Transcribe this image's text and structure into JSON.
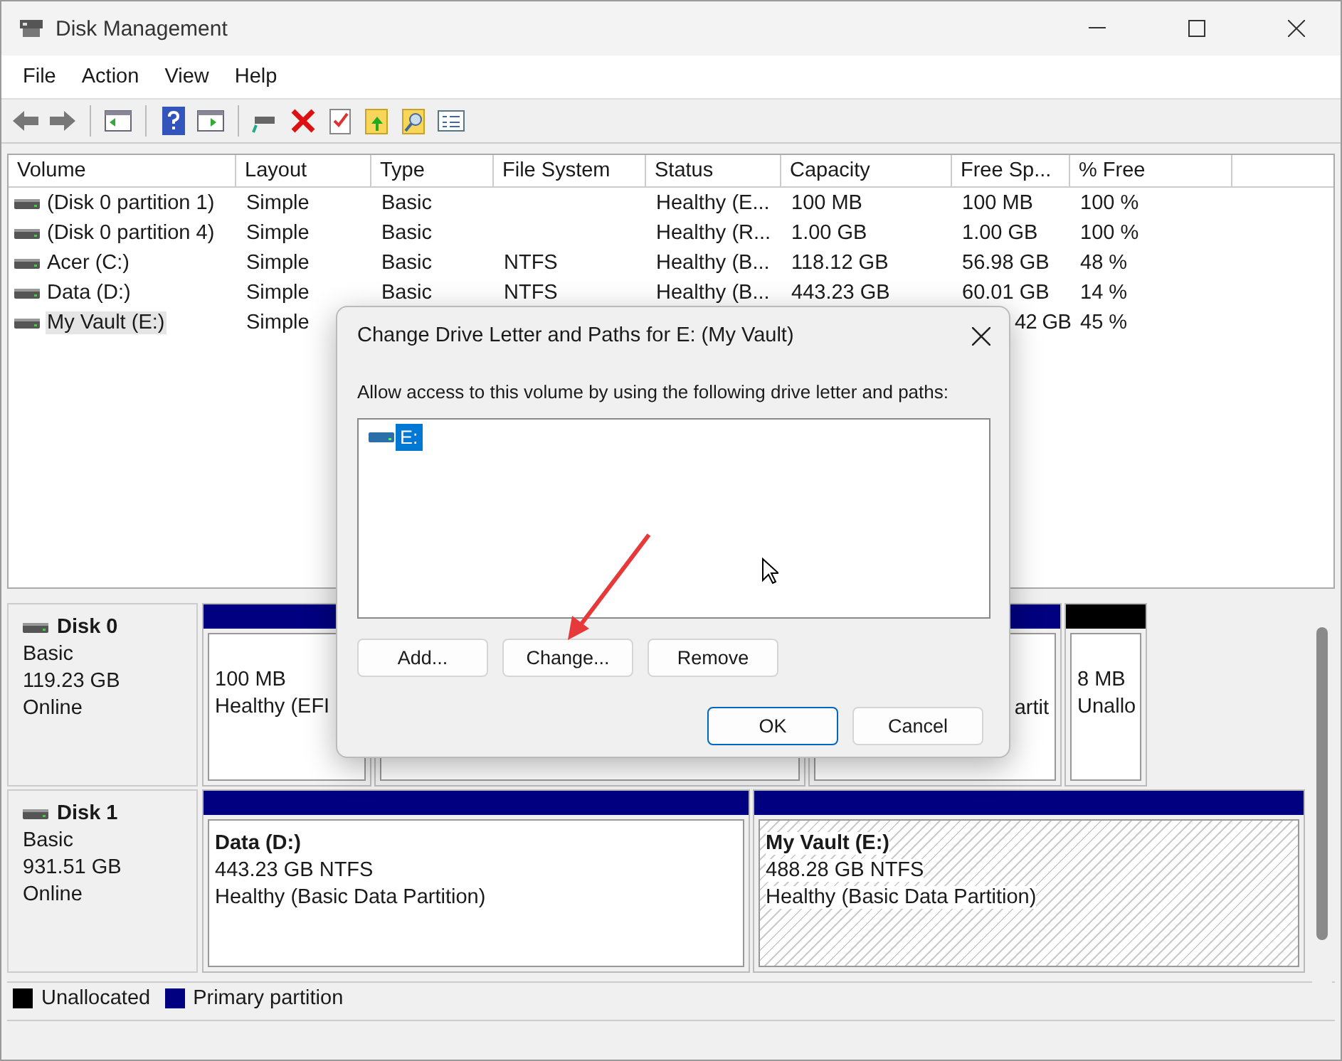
{
  "window": {
    "title": "Disk Management"
  },
  "menu": [
    "File",
    "Action",
    "View",
    "Help"
  ],
  "table": {
    "columns": [
      "Volume",
      "Layout",
      "Type",
      "File System",
      "Status",
      "Capacity",
      "Free Sp...",
      "% Free"
    ],
    "rows": [
      {
        "volume": "(Disk 0 partition 1)",
        "layout": "Simple",
        "type": "Basic",
        "file_system": "",
        "status": "Healthy (E...",
        "capacity": "100 MB",
        "free_space": "100 MB",
        "percent_free": "100 %",
        "selected": false
      },
      {
        "volume": "(Disk 0 partition 4)",
        "layout": "Simple",
        "type": "Basic",
        "file_system": "",
        "status": "Healthy (R...",
        "capacity": "1.00 GB",
        "free_space": "1.00 GB",
        "percent_free": "100 %",
        "selected": false
      },
      {
        "volume": "Acer (C:)",
        "layout": "Simple",
        "type": "Basic",
        "file_system": "NTFS",
        "status": "Healthy (B...",
        "capacity": "118.12 GB",
        "free_space": "56.98 GB",
        "percent_free": "48 %",
        "selected": false
      },
      {
        "volume": "Data (D:)",
        "layout": "Simple",
        "type": "Basic",
        "file_system": "NTFS",
        "status": "Healthy (B...",
        "capacity": "443.23 GB",
        "free_space": "60.01 GB",
        "percent_free": "14 %",
        "selected": false
      },
      {
        "volume": "My Vault (E:)",
        "layout": "Simple",
        "free_space": "42 GB",
        "percent_free": "45 %",
        "selected": true
      }
    ]
  },
  "disks": [
    {
      "name": "Disk 0",
      "type": "Basic",
      "size": "119.23 GB",
      "state": "Online",
      "partitions": [
        {
          "kind": "primary",
          "size": "100 MB",
          "status": "Healthy (EFI",
          "selected": false
        },
        {
          "selected": false
        },
        {
          "kind": "primary",
          "status": "artit",
          "selected": false
        },
        {
          "kind": "unallocated",
          "size": "8 MB",
          "status": "Unallo",
          "selected": false
        }
      ]
    },
    {
      "name": "Disk 1",
      "type": "Basic",
      "size": "931.51 GB",
      "state": "Online",
      "partitions": [
        {
          "kind": "primary",
          "label": "Data  (D:)",
          "size": "443.23 GB NTFS",
          "status": "Healthy (Basic Data Partition)",
          "selected": false
        },
        {
          "kind": "primary",
          "label": "My Vault  (E:)",
          "size": "488.28 GB NTFS",
          "status": "Healthy (Basic Data Partition)",
          "selected": true
        }
      ]
    }
  ],
  "legend": [
    {
      "label": "Unallocated",
      "color": "#000000"
    },
    {
      "label": "Primary partition",
      "color": "#000080"
    }
  ],
  "dialog": {
    "title": "Change Drive Letter and Paths for E: (My Vault)",
    "prompt": "Allow access to this volume by using the following drive letter and paths:",
    "paths": [
      {
        "label": "E:",
        "selected": true
      }
    ],
    "buttons": [
      "Add...",
      "Change...",
      "Remove"
    ],
    "footer_buttons": [
      {
        "label": "OK",
        "default": true
      },
      {
        "label": "Cancel",
        "default": false
      }
    ]
  }
}
